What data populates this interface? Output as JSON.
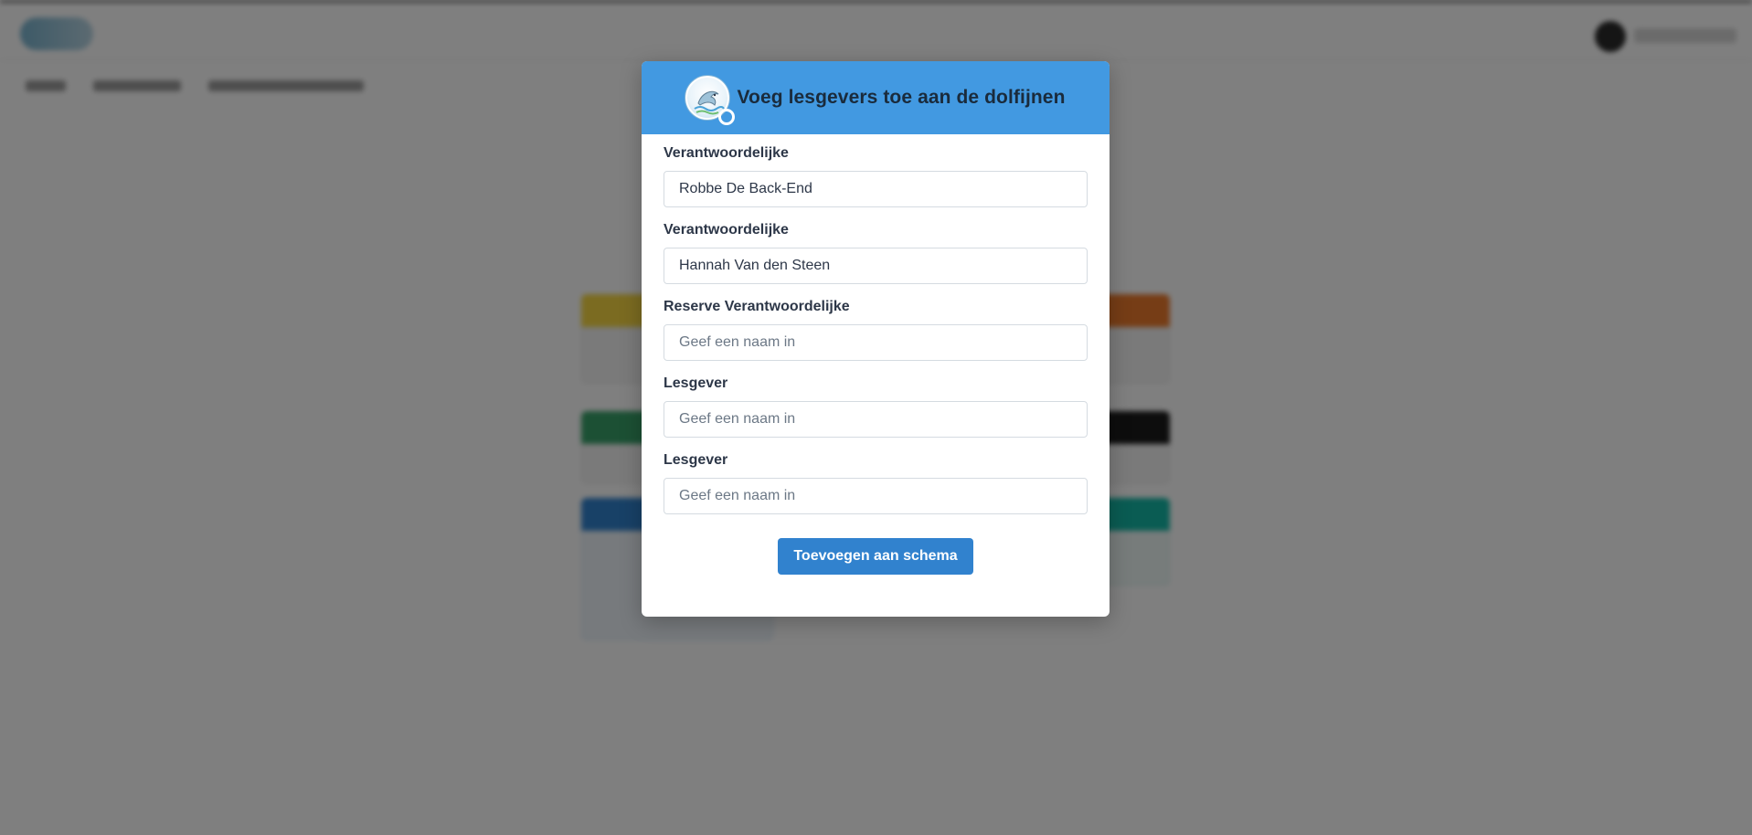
{
  "modal": {
    "title": "Voeg lesgevers toe aan de dolfijnen",
    "logo_icon": "dolphin-club-logo",
    "fields": [
      {
        "label": "Verantwoordelijke",
        "value": "Robbe De Back-End",
        "placeholder": "Geef een naam in"
      },
      {
        "label": "Verantwoordelijke",
        "value": "Hannah Van den Steen",
        "placeholder": "Geef een naam in"
      },
      {
        "label": "Reserve Verantwoordelijke",
        "value": "",
        "placeholder": "Geef een naam in"
      },
      {
        "label": "Lesgever",
        "value": "",
        "placeholder": "Geef een naam in"
      },
      {
        "label": "Lesgever",
        "value": "",
        "placeholder": "Geef een naam in"
      }
    ],
    "submit_label": "Toevoegen aan schema"
  },
  "colors": {
    "header": "#4299e1",
    "button": "#3182ce",
    "overlay": "rgba(0,0,0,0.5)",
    "card_yellow": "#f6d743",
    "card_orange": "#ed7b2c",
    "card_green": "#38a169",
    "card_black": "#1a1a1a",
    "card_blue": "#3182ce",
    "card_teal": "#14b8a6"
  }
}
